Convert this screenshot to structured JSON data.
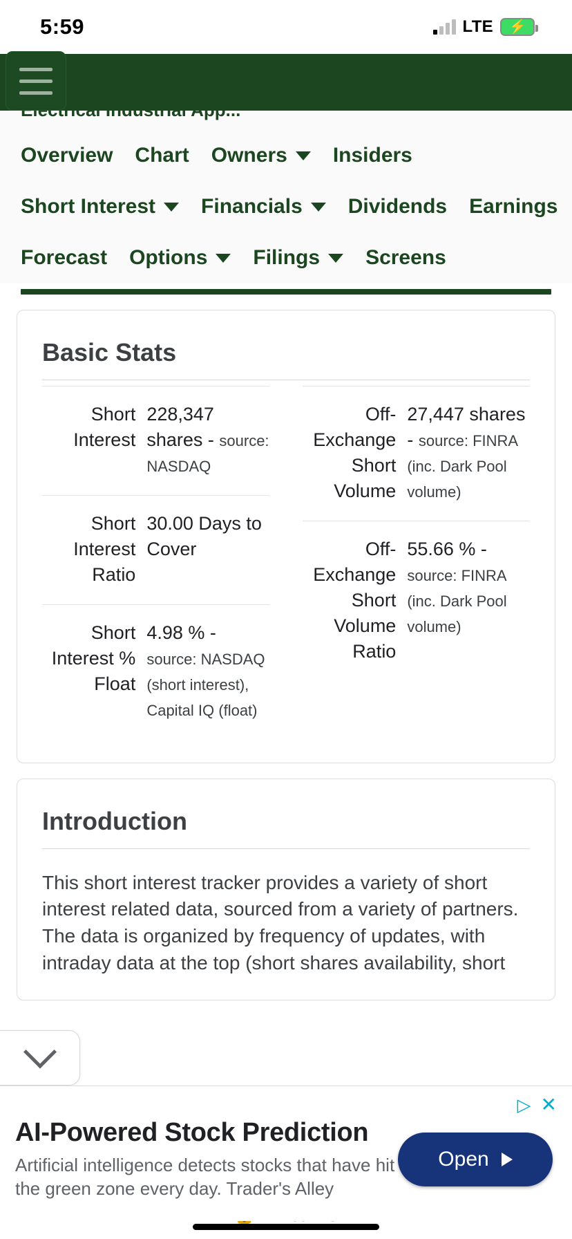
{
  "status_bar": {
    "time": "5:59",
    "network": "LTE",
    "battery_icon": "battery-charging-icon",
    "signal_icon": "cellular-signal-icon"
  },
  "app_bar": {
    "menu_icon": "hamburger-menu-icon",
    "background_color": "#1b4620"
  },
  "ticker": {
    "subtitle": "Electrical Industrial App..."
  },
  "nav": {
    "rows": [
      [
        {
          "label": "Overview",
          "has_dropdown": false
        },
        {
          "label": "Chart",
          "has_dropdown": false
        },
        {
          "label": "Owners",
          "has_dropdown": true
        },
        {
          "label": "Insiders",
          "has_dropdown": false
        }
      ],
      [
        {
          "label": "Short Interest",
          "has_dropdown": true
        },
        {
          "label": "Financials",
          "has_dropdown": true
        },
        {
          "label": "Dividends",
          "has_dropdown": false
        },
        {
          "label": "Earnings",
          "has_dropdown": false
        }
      ],
      [
        {
          "label": "Forecast",
          "has_dropdown": false
        },
        {
          "label": "Options",
          "has_dropdown": true
        },
        {
          "label": "Filings",
          "has_dropdown": true
        },
        {
          "label": "Screens",
          "has_dropdown": false
        }
      ]
    ]
  },
  "basic_stats": {
    "title": "Basic Stats",
    "left_column": [
      {
        "label": "Short Interest",
        "value": "228,347 shares -",
        "source": "source: NASDAQ"
      },
      {
        "label": "Short Interest Ratio",
        "value": "30.00 Days to Cover",
        "source": ""
      },
      {
        "label": "Short Interest % Float",
        "value": "4.98 % -",
        "source": "source: NASDAQ (short interest), Capital IQ (float)"
      }
    ],
    "right_column": [
      {
        "label": "Off-Exchange Short Volume",
        "value": "27,447 shares -",
        "source": "source: FINRA (inc. Dark Pool volume)"
      },
      {
        "label": "Off-Exchange Short Volume Ratio",
        "value": "55.66 % -",
        "source": "source: FINRA (inc. Dark Pool volume)"
      }
    ]
  },
  "introduction": {
    "title": "Introduction",
    "body": "This short interest tracker provides a variety of short interest related data, sourced from a variety of partners. The data is organized by frequency of updates, with intraday data at the top (short shares availability, short"
  },
  "overlay": {
    "collapse_icon": "chevron-down-icon"
  },
  "ad": {
    "adchoices_icon": "adchoices-icon",
    "close_icon": "close-icon",
    "headline": "AI-Powered Stock Prediction",
    "description": "Artificial intelligence detects stocks that have hit the green zone every day. Trader's Alley",
    "button_label": "Open",
    "button_arrow_icon": "play-arrow-icon",
    "button_color": "#17347a"
  },
  "browser_footer": {
    "lock_icon": "lock-icon",
    "url": "fintel.io"
  }
}
